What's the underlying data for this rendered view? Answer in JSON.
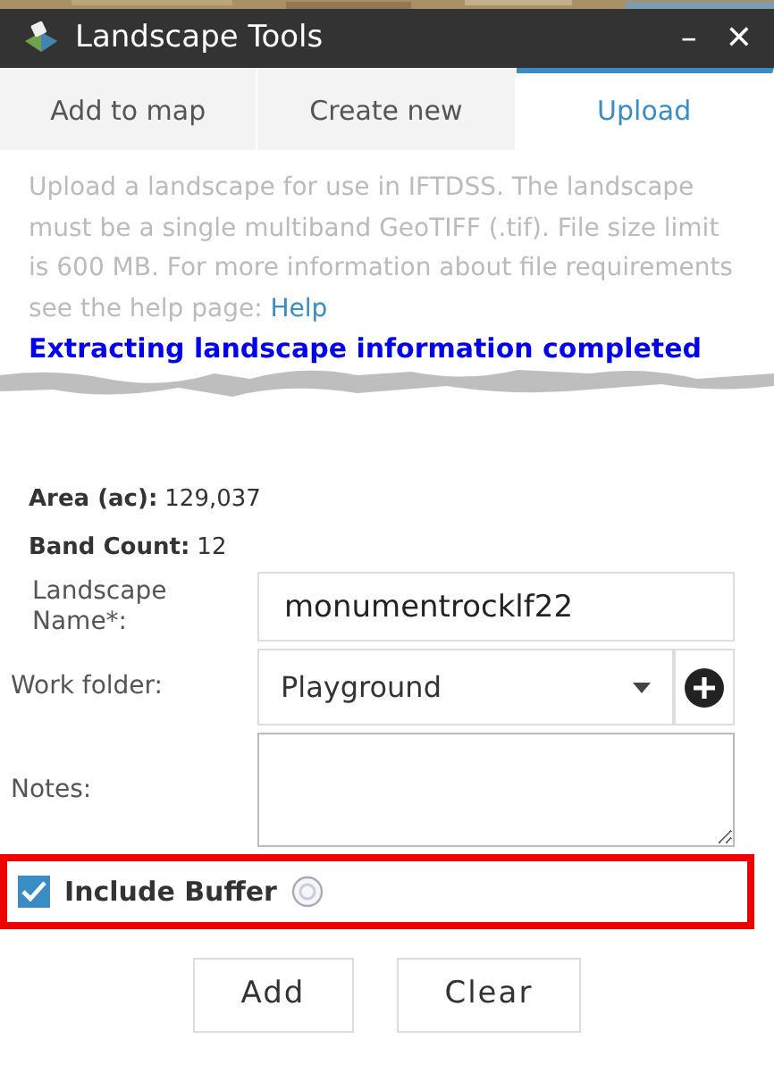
{
  "window": {
    "title": "Landscape Tools",
    "minimize": "–",
    "close": "✕"
  },
  "tabs": [
    {
      "label": "Add to map",
      "selected": false
    },
    {
      "label": "Create new",
      "selected": false
    },
    {
      "label": "Upload",
      "selected": true
    }
  ],
  "description": {
    "text": "Upload a landscape for use in IFTDSS. The landscape must be a single multiband GeoTIFF (.tif). File size limit is 600 MB. For more information about file requirements see the help page:",
    "link": "Help"
  },
  "status": "Extracting landscape information completed",
  "info": [
    {
      "label": "Area (ac):",
      "value": "129,037"
    },
    {
      "label": "Band Count:",
      "value": "12"
    }
  ],
  "fields": [
    {
      "kind": "text",
      "label": "Landscape Name*:",
      "value": "monumentrocklf22"
    },
    {
      "kind": "select",
      "label": "Work folder:",
      "value": "Playground"
    },
    {
      "kind": "textarea",
      "label": "Notes:"
    }
  ],
  "include_buffer": {
    "label": "Include Buffer",
    "checked": true,
    "highlighted": true
  },
  "buttons": [
    "Add",
    "Clear"
  ]
}
